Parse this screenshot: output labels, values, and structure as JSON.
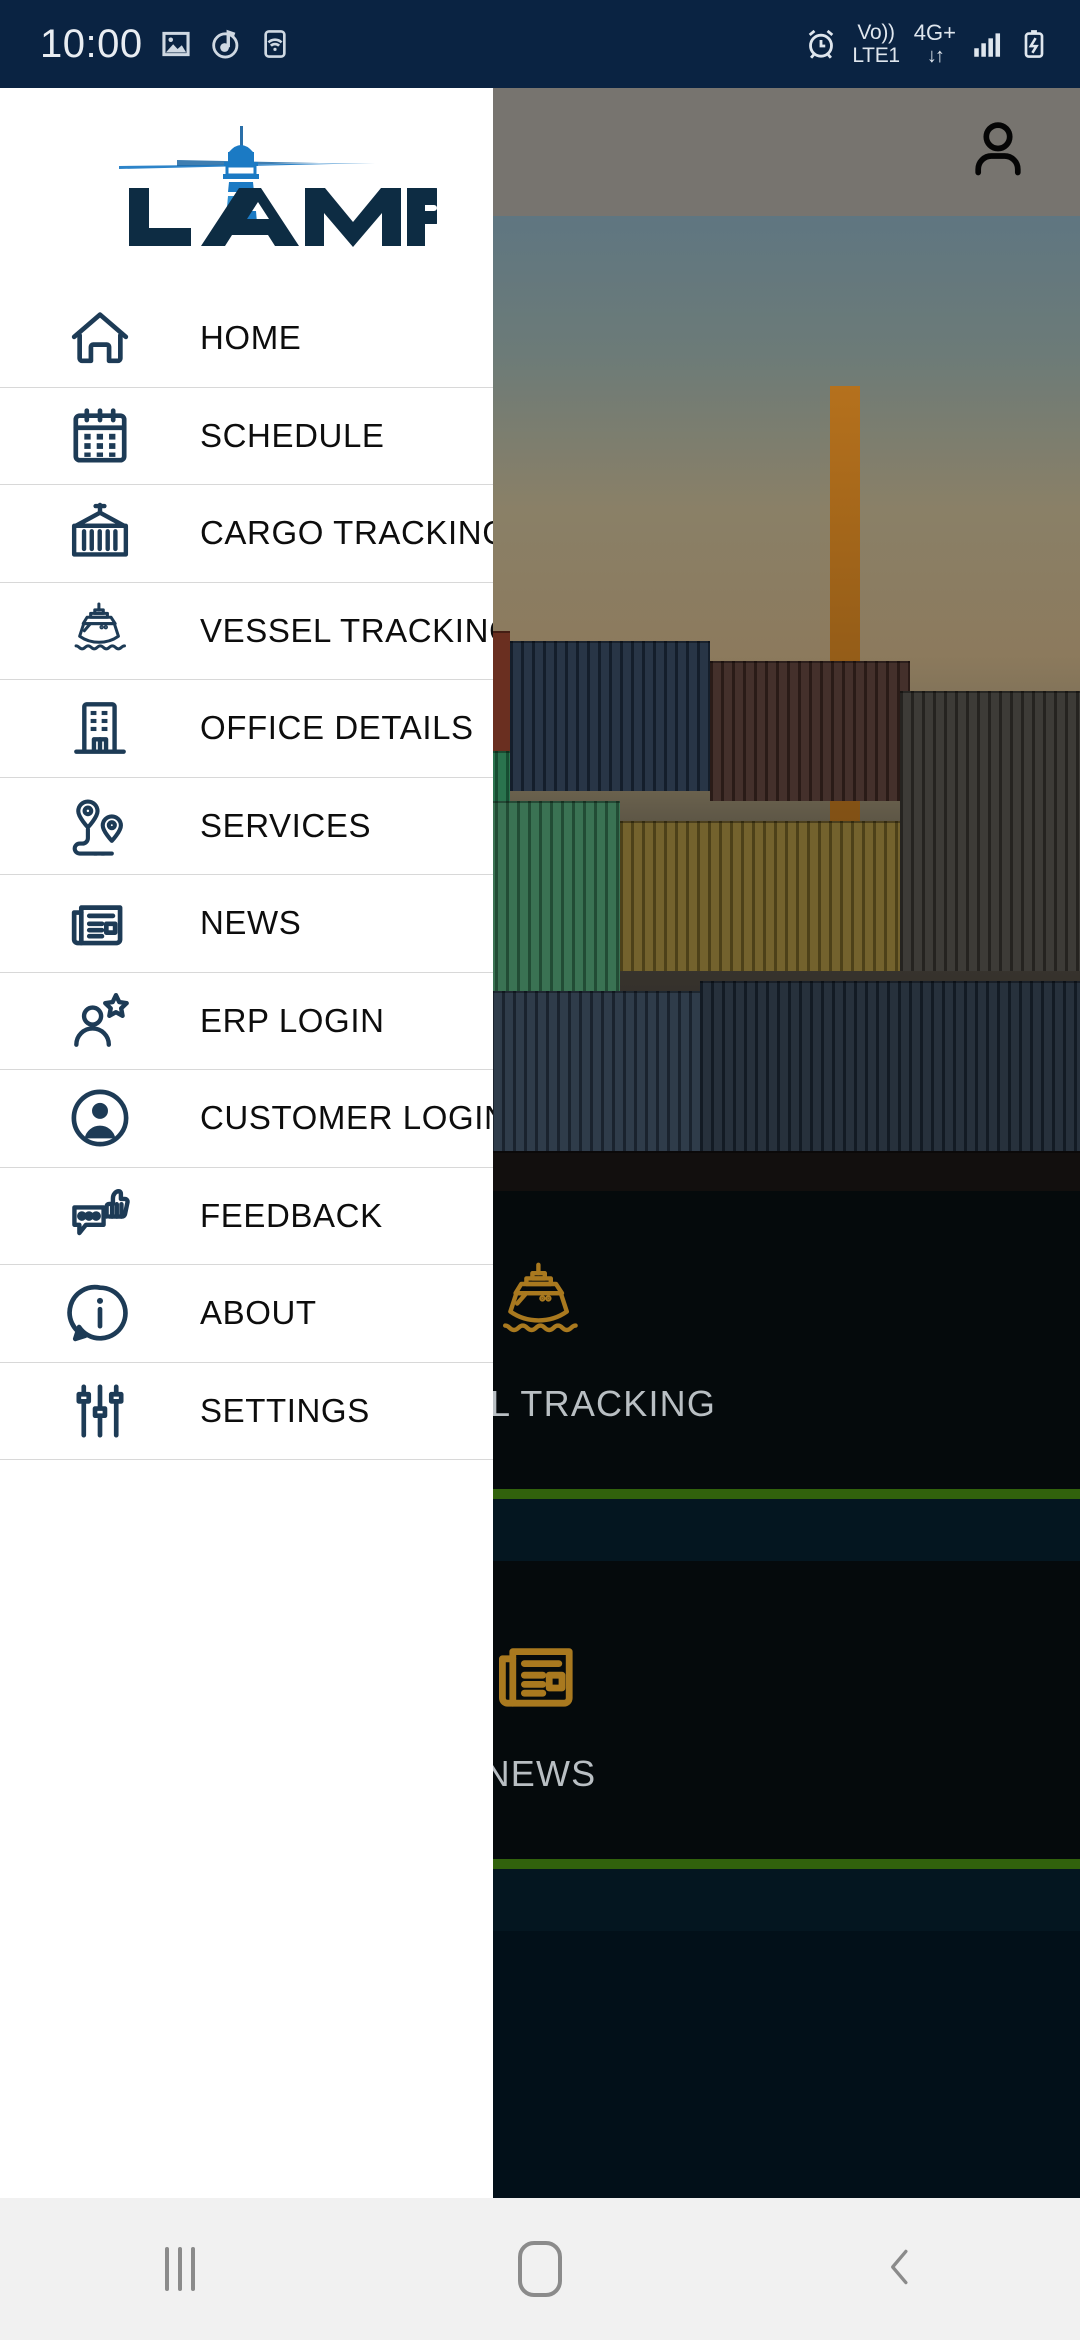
{
  "status_bar": {
    "time": "10:00",
    "left_icons": [
      "image-icon",
      "music-icon",
      "hotspot-icon"
    ],
    "right_icons": [
      "alarm-icon",
      "volte-icon",
      "network-icon",
      "signal-icon",
      "battery-charging-icon"
    ],
    "volte_line1": "Vo))",
    "volte_line2": "LTE1",
    "network_type": "4G+",
    "data_arrows": "↓↑",
    "background_color": "#0a2342"
  },
  "drawer": {
    "logo": {
      "text": "LAMP",
      "icon": "lighthouse-logo",
      "text_color": "#0d2c43",
      "mark_color": "#1b7ac4"
    },
    "items": [
      {
        "label": "HOME",
        "icon": "home-icon"
      },
      {
        "label": "SCHEDULE",
        "icon": "calendar-icon"
      },
      {
        "label": "CARGO TRACKING",
        "icon": "shipping-container-icon"
      },
      {
        "label": "VESSEL TRACKING",
        "icon": "ship-icon"
      },
      {
        "label": "OFFICE DETAILS",
        "icon": "building-icon"
      },
      {
        "label": "SERVICES",
        "icon": "map-route-pins-icon"
      },
      {
        "label": "NEWS",
        "icon": "newspaper-icon"
      },
      {
        "label": "ERP LOGIN",
        "icon": "user-star-icon"
      },
      {
        "label": "CUSTOMER LOGIN",
        "icon": "user-circle-icon"
      },
      {
        "label": "FEEDBACK",
        "icon": "thumbs-up-chat-icon"
      },
      {
        "label": "ABOUT",
        "icon": "info-bubble-icon"
      },
      {
        "label": "SETTINGS",
        "icon": "sliders-icon"
      }
    ],
    "icon_color": "#1d3b56",
    "divider_color": "#d8d8d8"
  },
  "app": {
    "top_bar": {
      "account_icon": "account-icon"
    },
    "hero": {
      "image": "port-terminal-cranes-containers-photo"
    },
    "cards": [
      {
        "label": "VESSEL TRACKING",
        "icon": "ship-icon"
      },
      {
        "label": "NEWS",
        "icon": "newspaper-icon"
      }
    ],
    "card_icon_color": "#a9791f",
    "card_label_color": "#b9bfc3",
    "card_accent_color": "#31620c"
  },
  "nav_bar": {
    "buttons": [
      {
        "name": "recents",
        "icon": "recents-icon"
      },
      {
        "name": "home",
        "icon": "home-nav-icon"
      },
      {
        "name": "back",
        "icon": "back-icon"
      }
    ],
    "background_color": "#f1f1f1",
    "glyph_color": "#8b8b8b"
  }
}
